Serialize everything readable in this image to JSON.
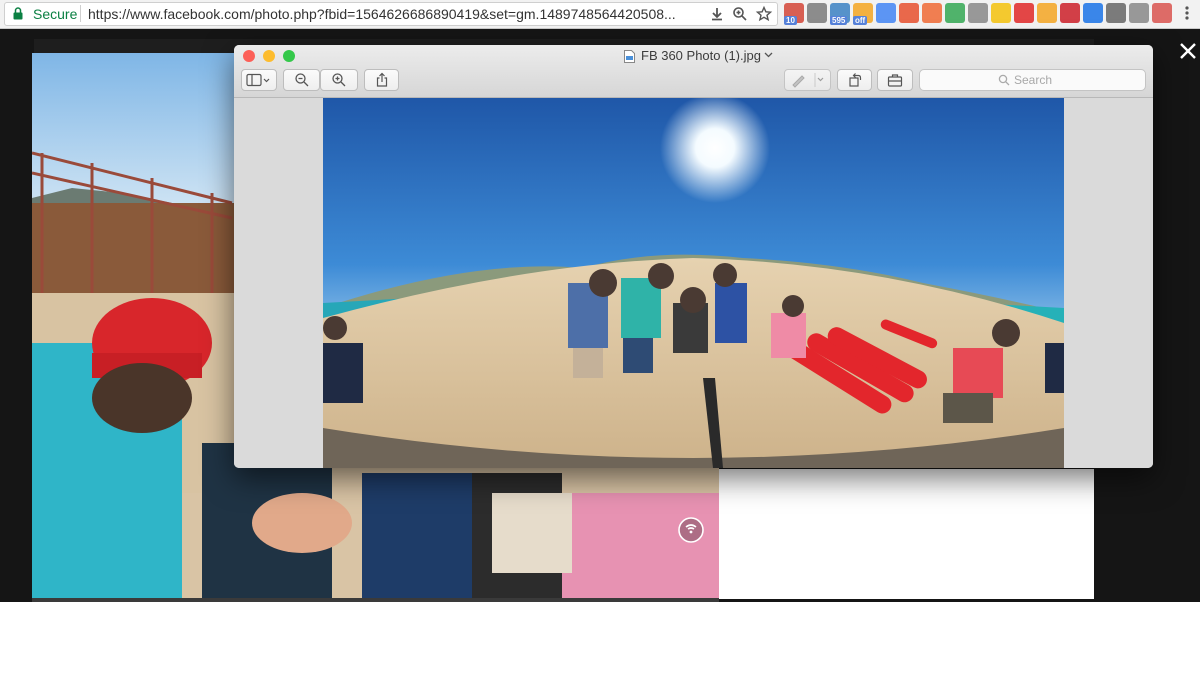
{
  "browser": {
    "secure_label": "Secure",
    "url": "https://www.facebook.com/photo.php?fbid=1564626686890419&set=gm.1489748564420508...",
    "extensions": [
      {
        "name": "calendar-extension-icon",
        "badge": "10",
        "color": "#d44638"
      },
      {
        "name": "rocket-extension-icon",
        "badge": "",
        "color": "#7a7a7a"
      },
      {
        "name": "photo-extension-icon",
        "badge": "595",
        "color": "#3b82c4"
      },
      {
        "name": "coupon-extension-icon",
        "badge": "off",
        "color": "#f5a623"
      },
      {
        "name": "translate-extension-icon",
        "badge": "",
        "color": "#4285f4"
      },
      {
        "name": "todo-extension-icon",
        "badge": "",
        "color": "#e8502e"
      },
      {
        "name": "timer-extension-icon",
        "badge": "",
        "color": "#f06a35"
      },
      {
        "name": "color-wheel-extension-icon",
        "badge": "",
        "color": "#34a853"
      },
      {
        "name": "fd-extension-icon",
        "badge": "",
        "color": "#888888"
      },
      {
        "name": "emoji-extension-icon",
        "badge": "",
        "color": "#f4c20d"
      },
      {
        "name": "flipboard-extension-icon",
        "badge": "",
        "color": "#e12828"
      },
      {
        "name": "honey-extension-icon",
        "badge": "",
        "color": "#f5a623"
      },
      {
        "name": "lastpass-extension-icon",
        "badge": "",
        "color": "#cc2029"
      },
      {
        "name": "arrow-extension-icon",
        "badge": "",
        "color": "#1a73e8"
      },
      {
        "name": "gear-extension-icon",
        "badge": "",
        "color": "#666666"
      },
      {
        "name": "ghost-extension-icon",
        "badge": "",
        "color": "#888888"
      },
      {
        "name": "360-extension-icon",
        "badge": "",
        "color": "#d9534f"
      }
    ]
  },
  "preview": {
    "filename": "FB 360 Photo (1).jpg",
    "search_placeholder": "Search",
    "traffic_colors": [
      "#fc5f57",
      "#fdbc2e",
      "#34c84a"
    ]
  }
}
